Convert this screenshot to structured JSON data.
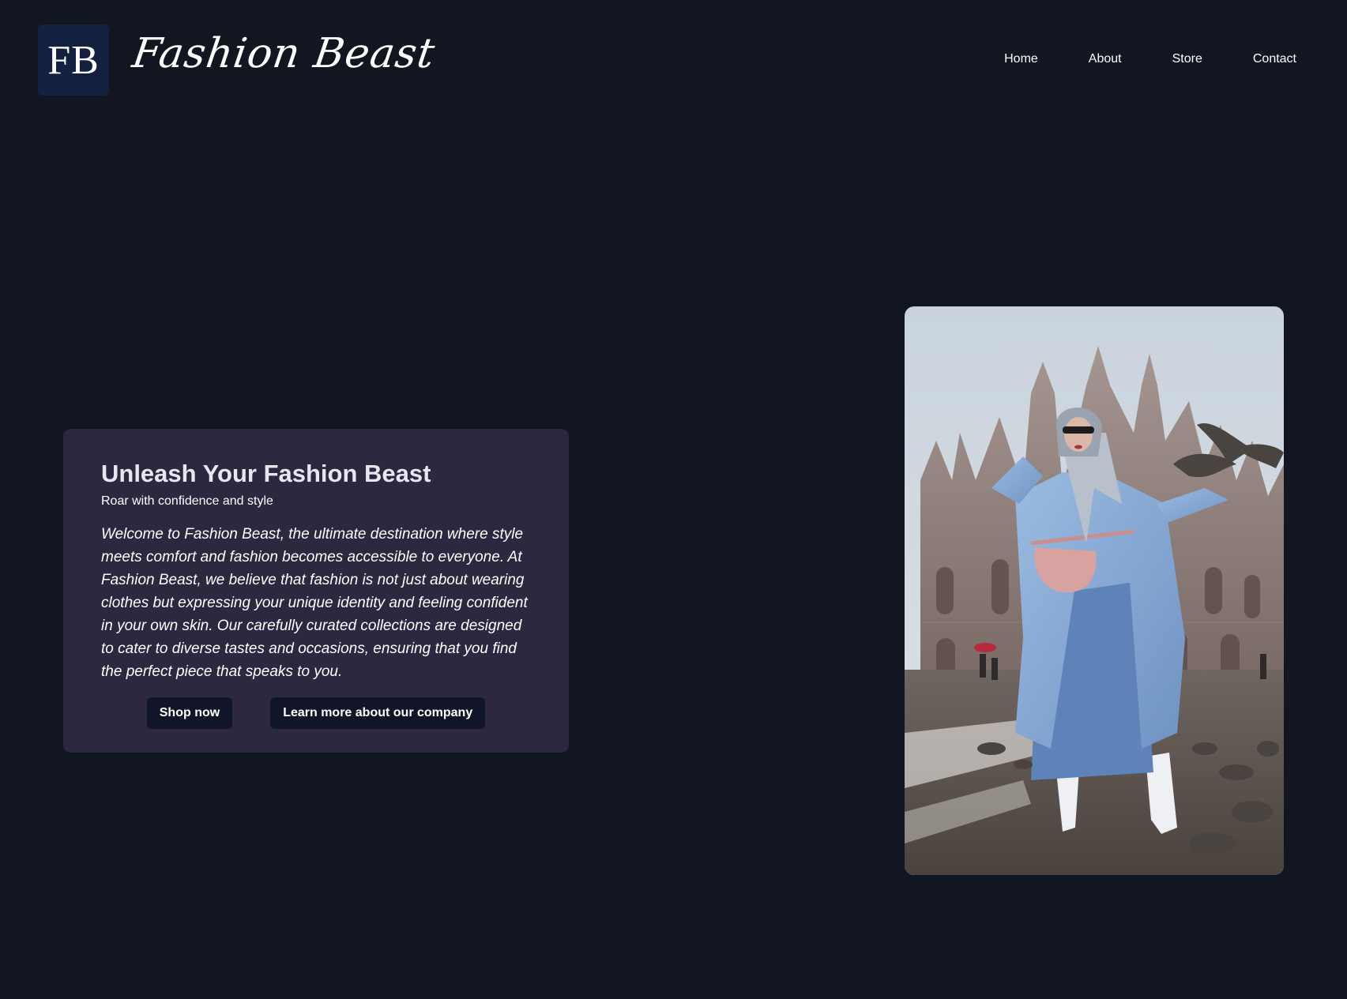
{
  "brand": {
    "logo_text": "FB",
    "name": "Fashion Beast"
  },
  "nav": {
    "items": [
      {
        "label": "Home"
      },
      {
        "label": "About"
      },
      {
        "label": "Store"
      },
      {
        "label": "Contact"
      }
    ]
  },
  "hero": {
    "title": "Unleash Your Fashion Beast",
    "subtitle": "Roar with confidence and style",
    "body": "Welcome to Fashion Beast, the ultimate destination where style meets comfort and fashion becomes accessible to everyone. At Fashion Beast, we believe that fashion is not just about wearing clothes but expressing your unique identity and feeling confident in your own skin. Our carefully curated collections are designed to cater to diverse tastes and occasions, ensuring that you find the perfect piece that speaks to you.",
    "primary_button": "Shop now",
    "secondary_button": "Learn more about our company"
  },
  "colors": {
    "background": "#121620",
    "card": "#2c2840",
    "logo_badge": "#14203f",
    "button": "#101628"
  }
}
